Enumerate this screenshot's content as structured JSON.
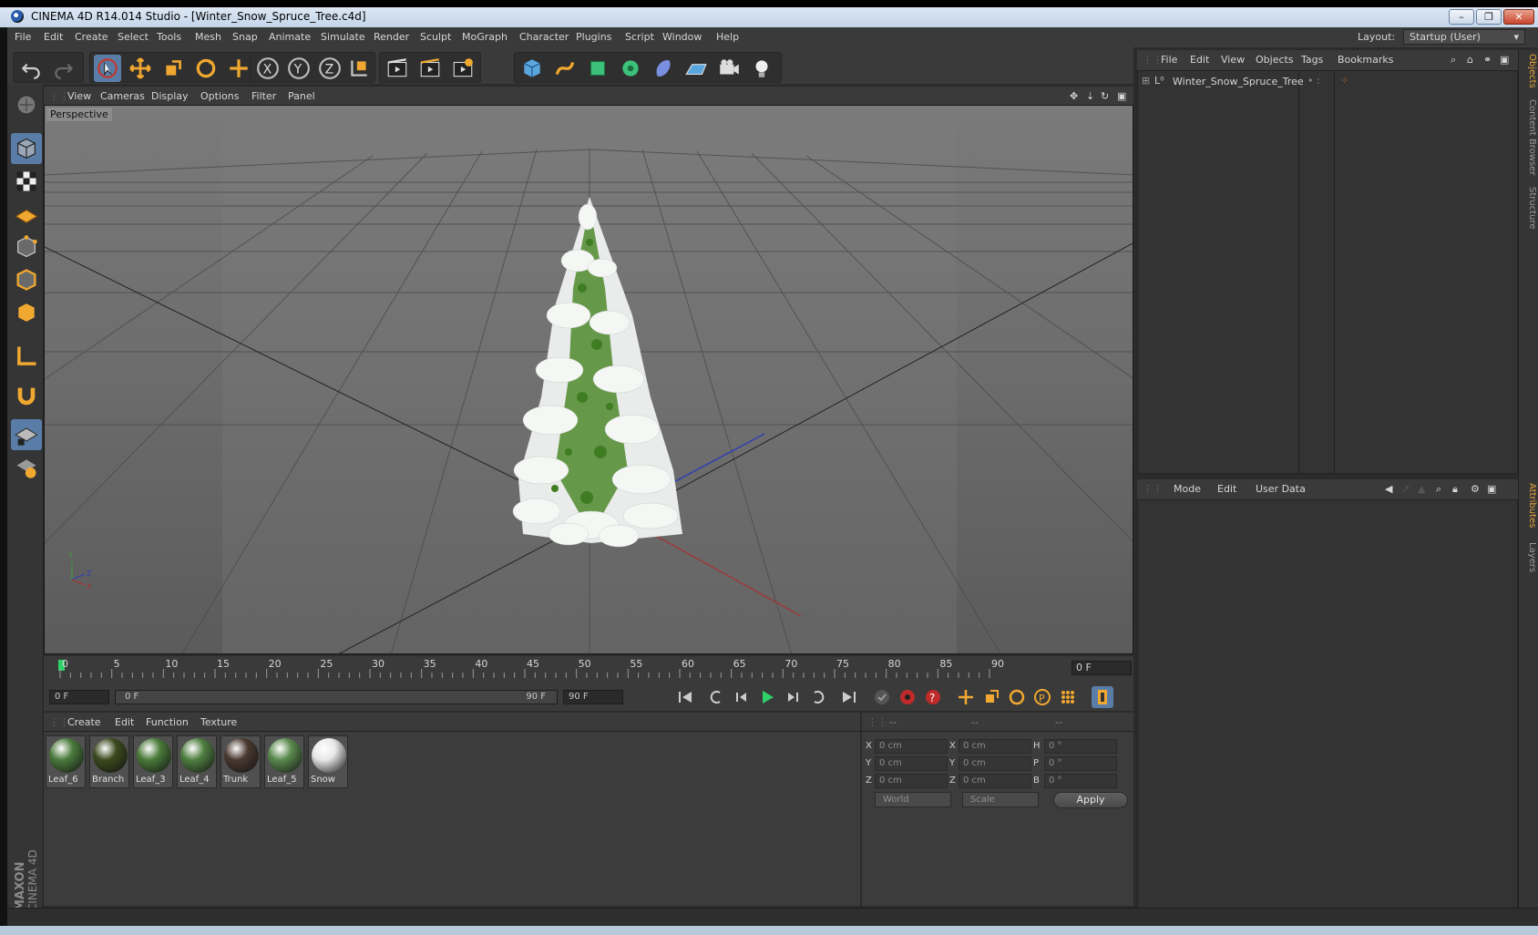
{
  "window": {
    "title": "CINEMA 4D R14.014 Studio - [Winter_Snow_Spruce_Tree.c4d]",
    "minimize": "–",
    "restore": "❐",
    "close": "✕"
  },
  "menu": [
    "File",
    "Edit",
    "Create",
    "Select",
    "Tools",
    "Mesh",
    "Snap",
    "Animate",
    "Simulate",
    "Render",
    "Sculpt",
    "MoGraph",
    "Character",
    "Plugins",
    "Script",
    "Window",
    "Help"
  ],
  "layout": {
    "label": "Layout:",
    "value": "Startup (User)"
  },
  "viewport": {
    "menu": [
      "View",
      "Cameras",
      "Display",
      "Options",
      "Filter",
      "Panel"
    ],
    "label": "Perspective"
  },
  "timeline": {
    "ticks": [
      "0",
      "5",
      "10",
      "15",
      "20",
      "25",
      "30",
      "35",
      "40",
      "45",
      "50",
      "55",
      "60",
      "65",
      "70",
      "75",
      "80",
      "85",
      "90"
    ],
    "current_frame": "0 F"
  },
  "transport": {
    "start": "0 F",
    "range_start": "0 F",
    "range_end": "90 F",
    "end": "90 F"
  },
  "materials": {
    "menu": [
      "Create",
      "Edit",
      "Function",
      "Texture"
    ],
    "items": [
      {
        "name": "Leaf_6",
        "color": "#4b7a3c"
      },
      {
        "name": "Branch",
        "color": "#3c4a1e"
      },
      {
        "name": "Leaf_3",
        "color": "#4a7a3a"
      },
      {
        "name": "Leaf_4",
        "color": "#4f7f40"
      },
      {
        "name": "Trunk",
        "color": "#4a3a30"
      },
      {
        "name": "Leaf_5",
        "color": "#5a8a4e"
      },
      {
        "name": "Snow",
        "color": "#e8e8e8"
      }
    ]
  },
  "coordinates": {
    "headers": [
      "--",
      "--",
      "--"
    ],
    "rows": [
      {
        "l1": "X",
        "v1": "0 cm",
        "l2": "X",
        "v2": "0 cm",
        "l3": "H",
        "v3": "0 °"
      },
      {
        "l1": "Y",
        "v1": "0 cm",
        "l2": "Y",
        "v2": "0 cm",
        "l3": "P",
        "v3": "0 °"
      },
      {
        "l1": "Z",
        "v1": "0 cm",
        "l2": "Z",
        "v2": "0 cm",
        "l3": "B",
        "v3": "0 °"
      }
    ],
    "mode1": "World",
    "mode2": "Scale",
    "apply": "Apply"
  },
  "objects": {
    "menu": [
      "File",
      "Edit",
      "View",
      "Objects",
      "Tags",
      "Bookmarks"
    ],
    "items": [
      "Winter_Snow_Spruce_Tree"
    ]
  },
  "attributes": {
    "menu": [
      "Mode",
      "Edit",
      "User Data"
    ]
  },
  "right_tabs": [
    "Objects",
    "Content Browser",
    "Structure",
    "Attributes",
    "Layers"
  ],
  "logo": {
    "brand": "MAXON",
    "product": "CINEMA 4D"
  },
  "colors": {
    "accent": "#e3a33b",
    "selected": "#5a7da8"
  }
}
